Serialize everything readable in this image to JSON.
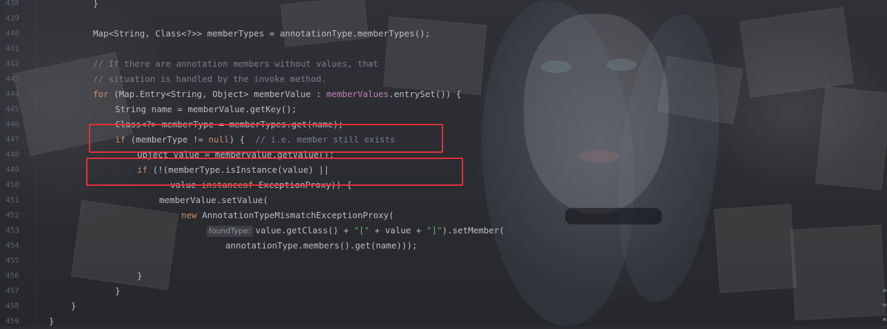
{
  "editor": {
    "lines": [
      {
        "no": "438",
        "tokens": [
          {
            "t": "}",
            "c": ""
          }
        ]
      },
      {
        "no": "439",
        "tokens": []
      },
      {
        "no": "440",
        "tokens": [
          {
            "t": "Map<String, Class<?>> memberTypes = annotationType.memberTypes();",
            "c": ""
          }
        ]
      },
      {
        "no": "441",
        "tokens": []
      },
      {
        "no": "442",
        "tokens": [
          {
            "t": "// If there are annotation members without values, that",
            "c": "cm"
          }
        ]
      },
      {
        "no": "443",
        "tokens": [
          {
            "t": "// situation is handled by the invoke method.",
            "c": "cm"
          }
        ]
      },
      {
        "no": "444",
        "tokens": [
          {
            "t": "for",
            "c": "kw"
          },
          {
            "t": " (Map.Entry<String, Object> memberValue : ",
            "c": ""
          },
          {
            "t": "memberValues",
            "c": "fld"
          },
          {
            "t": ".entrySet()) {",
            "c": ""
          }
        ]
      },
      {
        "no": "445",
        "tokens": [
          {
            "t": "String name = memberValue.getKey();",
            "c": ""
          }
        ]
      },
      {
        "no": "446",
        "tokens": [
          {
            "t": "Class<?> memberType = memberTypes.get(name);",
            "c": ""
          }
        ]
      },
      {
        "no": "447",
        "tokens": [
          {
            "t": "if",
            "c": "kw"
          },
          {
            "t": " (memberType != ",
            "c": ""
          },
          {
            "t": "null",
            "c": "kw"
          },
          {
            "t": ") {  ",
            "c": ""
          },
          {
            "t": "// i.e. member still exists",
            "c": "cm"
          }
        ]
      },
      {
        "no": "448",
        "tokens": [
          {
            "t": "Object value = memberValue.getValue();",
            "c": ""
          }
        ]
      },
      {
        "no": "449",
        "tokens": [
          {
            "t": "if",
            "c": "kw"
          },
          {
            "t": " (!(memberType.isInstance(value) ||",
            "c": ""
          }
        ]
      },
      {
        "no": "450",
        "tokens": [
          {
            "t": "value ",
            "c": ""
          },
          {
            "t": "instanceof",
            "c": "kw"
          },
          {
            "t": " ExceptionProxy)) {",
            "c": ""
          }
        ]
      },
      {
        "no": "451",
        "tokens": [
          {
            "t": "memberValue.setValue(",
            "c": ""
          }
        ]
      },
      {
        "no": "452",
        "tokens": [
          {
            "t": "new",
            "c": "kw"
          },
          {
            "t": " AnnotationTypeMismatchExceptionProxy(",
            "c": ""
          }
        ]
      },
      {
        "no": "453",
        "hint": "foundType:",
        "tokens": [
          {
            "t": "value.getClass() + ",
            "c": ""
          },
          {
            "t": "\"[\"",
            "c": "str"
          },
          {
            "t": " + value + ",
            "c": ""
          },
          {
            "t": "\"]\"",
            "c": "str"
          },
          {
            "t": ").setMember(",
            "c": ""
          }
        ]
      },
      {
        "no": "454",
        "tokens": [
          {
            "t": "annotationType.members().get(name)));",
            "c": ""
          }
        ]
      },
      {
        "no": "455",
        "tokens": []
      },
      {
        "no": "456",
        "tokens": [
          {
            "t": "}",
            "c": ""
          }
        ]
      },
      {
        "no": "457",
        "tokens": [
          {
            "t": "}",
            "c": ""
          }
        ]
      },
      {
        "no": "458",
        "tokens": [
          {
            "t": "}",
            "c": ""
          }
        ]
      },
      {
        "no": "459",
        "tokens": [
          {
            "t": "}",
            "c": ""
          }
        ]
      }
    ]
  },
  "colors": {
    "keyword": "#cf8e6d",
    "comment": "#7a7e85",
    "string": "#6aab73",
    "field": "#c77dbb",
    "text": "#bcbec4",
    "highlight_box": "#e8303c"
  }
}
